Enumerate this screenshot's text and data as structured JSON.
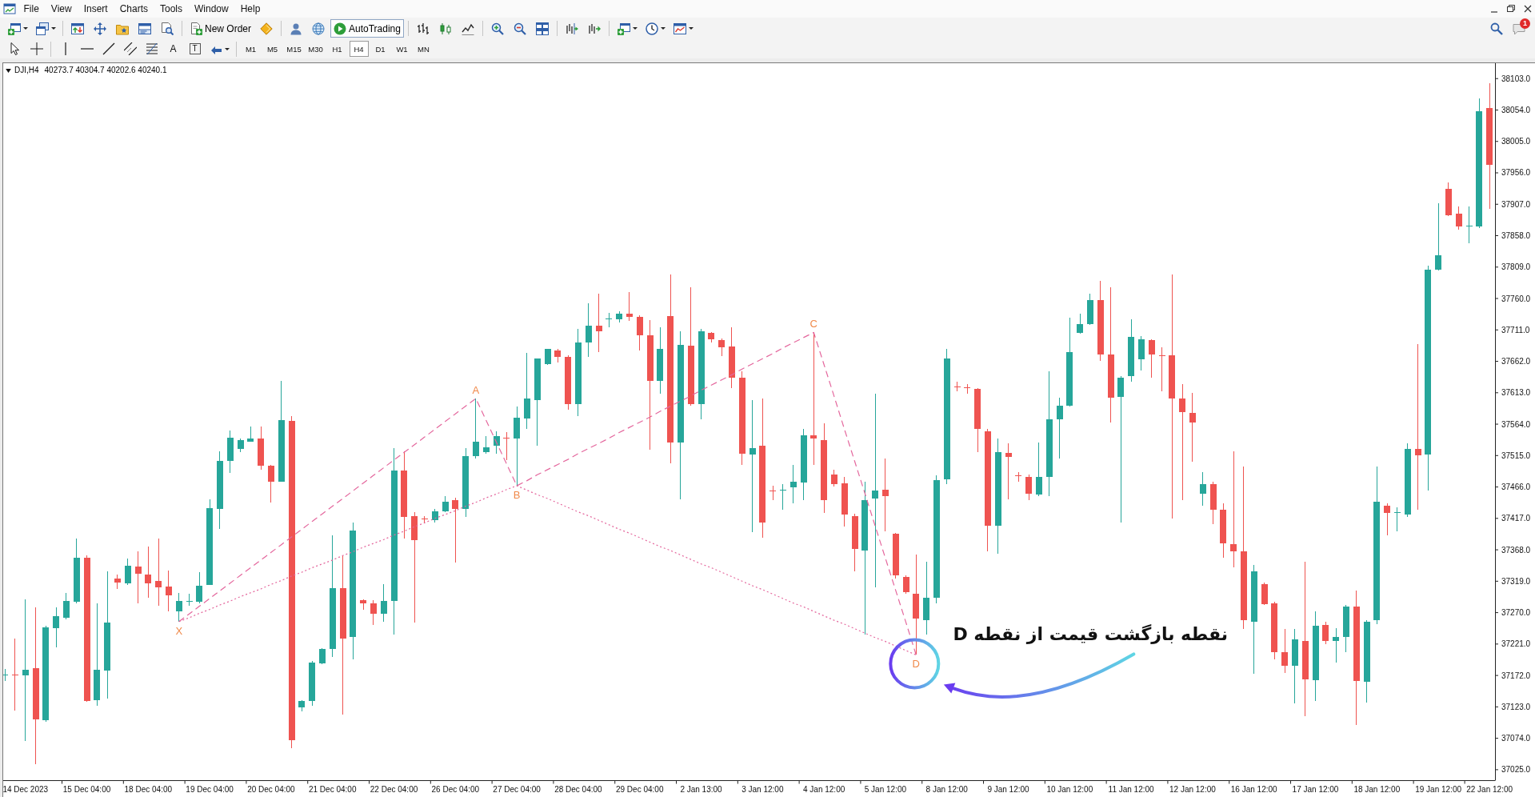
{
  "menu_bar": {
    "items": [
      "File",
      "View",
      "Insert",
      "Charts",
      "Tools",
      "Window",
      "Help"
    ]
  },
  "toolbar": {
    "new_order": {
      "label": "New Order"
    },
    "autotrading": {
      "label": "AutoTrading",
      "on": true
    },
    "notification_count": "1"
  },
  "drawing_tools": [
    {
      "kind": "cursor"
    },
    {
      "kind": "crosshair"
    },
    {
      "kind": "vertical-line"
    },
    {
      "kind": "horizontal-line"
    },
    {
      "kind": "trendline"
    },
    {
      "kind": "channel"
    },
    {
      "kind": "fibonacci"
    },
    {
      "kind": "text",
      "glyph": "A"
    },
    {
      "kind": "label",
      "glyph": "T"
    },
    {
      "kind": "arrows"
    }
  ],
  "timeframes": [
    {
      "label": "M1",
      "selected": false
    },
    {
      "label": "M5",
      "selected": false
    },
    {
      "label": "M15",
      "selected": false
    },
    {
      "label": "M30",
      "selected": false
    },
    {
      "label": "H1",
      "selected": false
    },
    {
      "label": "H4",
      "selected": true
    },
    {
      "label": "D1",
      "selected": false
    },
    {
      "label": "W1",
      "selected": false
    },
    {
      "label": "MN",
      "selected": false
    }
  ],
  "chart": {
    "quote": "40273.7 40304.7 40202.6 40240.1",
    "callout": {
      "text": "نقطه بازگشت قیمت از نقطه D"
    },
    "chart_data": [
      {
        "type": "candlestick",
        "title": "DJI,H4",
        "categories": [
          null,
          null,
          "14 Dec 2023",
          null,
          null,
          null,
          null,
          null,
          "15 Dec 04:00",
          null,
          null,
          null,
          null,
          null,
          "18 Dec 04:00",
          null,
          null,
          null,
          null,
          null,
          "19 Dec 04:00",
          null,
          null,
          null,
          null,
          null,
          "20 Dec 04:00",
          null,
          null,
          null,
          null,
          null,
          "21 Dec 04:00",
          null,
          null,
          null,
          null,
          null,
          "22 Dec 04:00",
          null,
          null,
          null,
          null,
          null,
          "26 Dec 04:00",
          null,
          null,
          null,
          null,
          null,
          "27 Dec 04:00",
          null,
          null,
          null,
          null,
          null,
          "28 Dec 04:00",
          null,
          null,
          null,
          null,
          null,
          "29 Dec 04:00",
          null,
          null,
          null,
          null,
          null,
          "2 Jan 13:00",
          null,
          null,
          null,
          null,
          null,
          "3 Jan 12:00",
          null,
          null,
          null,
          null,
          null,
          "4 Jan 12:00",
          null,
          null,
          null,
          null,
          null,
          "5 Jan 12:00",
          null,
          null,
          null,
          null,
          null,
          "8 Jan 12:00",
          null,
          null,
          null,
          null,
          null,
          "9 Jan 12:00",
          null,
          null,
          null,
          null,
          null,
          "10 Jan 12:00",
          null,
          null,
          null,
          null,
          null,
          "11 Jan 12:00",
          null,
          null,
          null,
          null,
          null,
          "12 Jan 12:00",
          null,
          null,
          null,
          null,
          null,
          "16 Jan 12:00",
          null,
          null,
          null,
          null,
          null,
          "17 Jan 12:00",
          null,
          null,
          null,
          null,
          null,
          "18 Jan 12:00",
          null,
          null,
          null,
          null,
          null,
          "19 Jan 12:00",
          null,
          null,
          null,
          null,
          "22 Jan 12:00"
        ],
        "ylim": [
          37008,
          38127
        ],
        "yticks": [
          {
            "value": 38103,
            "label": "38103.0"
          },
          {
            "value": 38054,
            "label": "38054.0"
          },
          {
            "value": 38005,
            "label": "38005.0"
          },
          {
            "value": 37956,
            "label": "37956.0"
          },
          {
            "value": 37907,
            "label": "37907.0"
          },
          {
            "value": 37858,
            "label": "37858.0"
          },
          {
            "value": 37809,
            "label": "37809.0"
          },
          {
            "value": 37760,
            "label": "37760.0"
          },
          {
            "value": 37711,
            "label": "37711.0"
          },
          {
            "value": 37662,
            "label": "37662.0"
          },
          {
            "value": 37613,
            "label": "37613.0"
          },
          {
            "value": 37564,
            "label": "37564.0"
          },
          {
            "value": 37515,
            "label": "37515.0"
          },
          {
            "value": 37466,
            "label": "37466.0"
          },
          {
            "value": 37417,
            "label": "37417.0"
          },
          {
            "value": 37368,
            "label": "37368.0"
          },
          {
            "value": 37319,
            "label": "37319.0"
          },
          {
            "value": 37270,
            "label": "37270.0"
          },
          {
            "value": 37221,
            "label": "37221.0"
          },
          {
            "value": 37172,
            "label": "37172.0"
          },
          {
            "value": 37123,
            "label": "37123.0"
          },
          {
            "value": 37074,
            "label": "37074.0"
          },
          {
            "value": 37025,
            "label": "37025.0"
          }
        ],
        "ohlc": [
          [
            37172,
            37182,
            37163,
            37173
          ],
          [
            37173,
            37230,
            37117,
            37172
          ],
          [
            37172,
            37291,
            37070,
            37181
          ],
          [
            37183,
            37278,
            37033,
            37103
          ],
          [
            37102,
            37249,
            37100,
            37247
          ],
          [
            37246,
            37278,
            37216,
            37264
          ],
          [
            37262,
            37301,
            37260,
            37288
          ],
          [
            37287,
            37386,
            37285,
            37356
          ],
          [
            37356,
            37359,
            37131,
            37132
          ],
          [
            37134,
            37285,
            37125,
            37181
          ],
          [
            37180,
            37335,
            37136,
            37255
          ],
          [
            37323,
            37330,
            37307,
            37317
          ],
          [
            37316,
            37354,
            37313,
            37343
          ],
          [
            37342,
            37365,
            37285,
            37331
          ],
          [
            37330,
            37373,
            37293,
            37316
          ],
          [
            37320,
            37385,
            37281,
            37310
          ],
          [
            37311,
            37336,
            37272,
            37297
          ],
          [
            37272,
            37301,
            37256,
            37288
          ],
          [
            37287,
            37299,
            37281,
            37288
          ],
          [
            37287,
            37333,
            37285,
            37312
          ],
          [
            37313,
            37447,
            37313,
            37433
          ],
          [
            37432,
            37522,
            37401,
            37507
          ],
          [
            37507,
            37554,
            37488,
            37543
          ],
          [
            37525,
            37541,
            37520,
            37539
          ],
          [
            37537,
            37560,
            37536,
            37542
          ],
          [
            37542,
            37560,
            37493,
            37499
          ],
          [
            37499,
            37501,
            37442,
            37474
          ],
          [
            37474,
            37631,
            37474,
            37570
          ],
          [
            37569,
            37577,
            37058,
            37071
          ],
          [
            37122,
            37134,
            37116,
            37132
          ],
          [
            37132,
            37195,
            37125,
            37192
          ],
          [
            37191,
            37214,
            37190,
            37213
          ],
          [
            37213,
            37390,
            37201,
            37308
          ],
          [
            37308,
            37359,
            37111,
            37230
          ],
          [
            37232,
            37410,
            37197,
            37398
          ],
          [
            37289,
            37291,
            37274,
            37285
          ],
          [
            37285,
            37289,
            37251,
            37268
          ],
          [
            37268,
            37314,
            37256,
            37288
          ],
          [
            37288,
            37527,
            37236,
            37492
          ],
          [
            37492,
            37522,
            37386,
            37419
          ],
          [
            37421,
            37427,
            37255,
            37383
          ],
          [
            37417,
            37421,
            37411,
            37416
          ],
          [
            37414,
            37432,
            37411,
            37428
          ],
          [
            37428,
            37452,
            37427,
            37443
          ],
          [
            37446,
            37449,
            37348,
            37432
          ],
          [
            37432,
            37526,
            37419,
            37514
          ],
          [
            37514,
            37604,
            37511,
            37536
          ],
          [
            37520,
            37545,
            37518,
            37528
          ],
          [
            37530,
            37553,
            37518,
            37545
          ],
          [
            37543,
            37551,
            37508,
            37542
          ],
          [
            37541,
            37591,
            37467,
            37574
          ],
          [
            37573,
            37675,
            37556,
            37604
          ],
          [
            37602,
            37667,
            37530,
            37666
          ],
          [
            37658,
            37682,
            37656,
            37681
          ],
          [
            37679,
            37682,
            37660,
            37669
          ],
          [
            37669,
            37671,
            37587,
            37595
          ],
          [
            37595,
            37713,
            37577,
            37692
          ],
          [
            37692,
            37753,
            37669,
            37717
          ],
          [
            37717,
            37768,
            37676,
            37709
          ],
          [
            37728,
            37737,
            37715,
            37729
          ],
          [
            37728,
            37740,
            37722,
            37736
          ],
          [
            37736,
            37770,
            37725,
            37731
          ],
          [
            37731,
            37734,
            37679,
            37703
          ],
          [
            37703,
            37726,
            37524,
            37631
          ],
          [
            37631,
            37715,
            37612,
            37682
          ],
          [
            37732,
            37797,
            37503,
            37535
          ],
          [
            37535,
            37709,
            37447,
            37688
          ],
          [
            37686,
            37778,
            37593,
            37595
          ],
          [
            37595,
            37713,
            37572,
            37709
          ],
          [
            37706,
            37708,
            37692,
            37696
          ],
          [
            37695,
            37698,
            37670,
            37684
          ],
          [
            37685,
            37715,
            37620,
            37637
          ],
          [
            37637,
            37647,
            37501,
            37518
          ],
          [
            37517,
            37602,
            37396,
            37527
          ],
          [
            37530,
            37604,
            37387,
            37411
          ],
          [
            37460,
            37468,
            37445,
            37459
          ],
          [
            37460,
            37471,
            37430,
            37462
          ],
          [
            37465,
            37500,
            37441,
            37474
          ],
          [
            37473,
            37556,
            37445,
            37546
          ],
          [
            37547,
            37707,
            37500,
            37541
          ],
          [
            37539,
            37565,
            37426,
            37445
          ],
          [
            37485,
            37493,
            37467,
            37471
          ],
          [
            37472,
            37482,
            37404,
            37423
          ],
          [
            37421,
            37424,
            37334,
            37369
          ],
          [
            37367,
            37474,
            37236,
            37446
          ],
          [
            37448,
            37611,
            37310,
            37461
          ],
          [
            37462,
            37510,
            37397,
            37452
          ],
          [
            37393,
            37394,
            37323,
            37328
          ],
          [
            37326,
            37328,
            37300,
            37302
          ],
          [
            37300,
            37360,
            37204,
            37261
          ],
          [
            37258,
            37350,
            37236,
            37293
          ],
          [
            37293,
            37484,
            37284,
            37477
          ],
          [
            37478,
            37682,
            37471,
            37667
          ],
          [
            37623,
            37630,
            37615,
            37622
          ],
          [
            37621,
            37626,
            37611,
            37620
          ],
          [
            37619,
            37620,
            37521,
            37556
          ],
          [
            37553,
            37556,
            37365,
            37406
          ],
          [
            37406,
            37541,
            37362,
            37521
          ],
          [
            37519,
            37534,
            37447,
            37513
          ],
          [
            37484,
            37489,
            37474,
            37483
          ],
          [
            37482,
            37485,
            37445,
            37456
          ],
          [
            37454,
            37535,
            37452,
            37482
          ],
          [
            37482,
            37646,
            37452,
            37571
          ],
          [
            37571,
            37605,
            37511,
            37593
          ],
          [
            37593,
            37730,
            37591,
            37676
          ],
          [
            37706,
            37736,
            37705,
            37720
          ],
          [
            37720,
            37767,
            37719,
            37758
          ],
          [
            37758,
            37787,
            37663,
            37673
          ],
          [
            37673,
            37778,
            37567,
            37605
          ],
          [
            37606,
            37639,
            37411,
            37637
          ],
          [
            37639,
            37728,
            37630,
            37700
          ],
          [
            37665,
            37701,
            37648,
            37696
          ],
          [
            37695,
            37696,
            37637,
            37673
          ],
          [
            37672,
            37684,
            37615,
            37671
          ],
          [
            37672,
            37798,
            37417,
            37604
          ],
          [
            37604,
            37626,
            37445,
            37583
          ],
          [
            37582,
            37613,
            37506,
            37567
          ],
          [
            37456,
            37489,
            37437,
            37471
          ],
          [
            37471,
            37474,
            37408,
            37430
          ],
          [
            37430,
            37441,
            37356,
            37378
          ],
          [
            37377,
            37522,
            37341,
            37366
          ],
          [
            37365,
            37498,
            37245,
            37258
          ],
          [
            37256,
            37345,
            37175,
            37335
          ],
          [
            37315,
            37317,
            37282,
            37283
          ],
          [
            37284,
            37287,
            37197,
            37208
          ],
          [
            37208,
            37245,
            37176,
            37187
          ],
          [
            37187,
            37245,
            37128,
            37228
          ],
          [
            37226,
            37349,
            37108,
            37166
          ],
          [
            37165,
            37272,
            37132,
            37249
          ],
          [
            37251,
            37256,
            37221,
            37226
          ],
          [
            37226,
            37246,
            37192,
            37232
          ],
          [
            37232,
            37282,
            37208,
            37280
          ],
          [
            37280,
            37304,
            37095,
            37164
          ],
          [
            37162,
            37258,
            37130,
            37256
          ],
          [
            37258,
            37498,
            37252,
            37443
          ],
          [
            37437,
            37441,
            37391,
            37425
          ],
          [
            37426,
            37434,
            37397,
            37427
          ],
          [
            37423,
            37534,
            37419,
            37525
          ],
          [
            37525,
            37689,
            37430,
            37515
          ],
          [
            37517,
            37811,
            37461,
            37805
          ],
          [
            37805,
            37909,
            37804,
            37827
          ],
          [
            37931,
            37941,
            37889,
            37890
          ],
          [
            37892,
            37904,
            37867,
            37872
          ],
          [
            37872,
            37904,
            37846,
            37873
          ],
          [
            37872,
            38072,
            37870,
            38052
          ],
          [
            38057,
            38096,
            37900,
            37969
          ]
        ],
        "series": [
          {
            "type": "line",
            "line_style": "dashed",
            "color": "#e4679d",
            "values": [
              null,
              null,
              null,
              null,
              null,
              null,
              null,
              null,
              null,
              null,
              null,
              null,
              null,
              null,
              null,
              null,
              null,
              37256,
              37268,
              37280,
              37292,
              37304,
              37316,
              37328,
              37340,
              37352,
              37364,
              37376,
              37388,
              37400,
              37412,
              37424,
              37436,
              37448,
              37460,
              37472,
              37484,
              37496,
              37508,
              37520,
              37532,
              37544,
              37556,
              37568,
              37580,
              37592,
              37604,
              37570,
              37536,
              37502,
              37468,
              37476,
              37485,
              37493,
              37501,
              37509,
              37518,
              37526,
              37534,
              37542,
              37551,
              37559,
              37567,
              37575,
              37584,
              37592,
              37600,
              37608,
              37617,
              37625,
              37633,
              37641,
              37650,
              37658,
              37666,
              37674,
              37683,
              37691,
              37699,
              37707,
              37657,
              37607,
              37556,
              37506,
              37456,
              37405,
              37355,
              37305,
              37255,
              37204,
              null,
              null,
              null,
              null,
              null,
              null,
              null,
              null,
              null,
              null,
              null,
              null,
              null,
              null,
              null,
              null,
              null,
              null,
              null,
              null,
              null,
              null,
              null,
              null,
              null,
              null,
              null,
              null,
              null,
              null,
              null,
              null,
              null,
              null,
              null,
              null,
              null,
              null,
              null,
              null,
              null,
              null,
              null,
              null,
              null,
              null,
              null,
              null,
              null,
              null,
              null,
              null,
              null,
              null,
              null,
              null
            ]
          },
          {
            "type": "line",
            "line_style": "dotted",
            "color": "#e4679d",
            "values": [
              null,
              null,
              null,
              null,
              null,
              null,
              null,
              null,
              null,
              null,
              null,
              null,
              null,
              null,
              null,
              null,
              null,
              37256,
              37262,
              37269,
              37275,
              37282,
              37288,
              37295,
              37301,
              37307,
              37314,
              37320,
              37327,
              37333,
              37340,
              37346,
              37352,
              37359,
              37365,
              37372,
              37378,
              37384,
              37391,
              37397,
              37404,
              37410,
              37417,
              37423,
              37429,
              37436,
              37442,
              37449,
              37455,
              37462,
              37468,
              37461,
              37454,
              37448,
              37441,
              37434,
              37427,
              37421,
              37414,
              37407,
              37400,
              37394,
              37387,
              37380,
              37373,
              37367,
              37360,
              37353,
              37346,
              37340,
              37333,
              37326,
              37319,
              37312,
              37306,
              37299,
              37292,
              37285,
              37279,
              37272,
              37265,
              37258,
              37252,
              37245,
              37238,
              37231,
              37225,
              37218,
              37211,
              37204,
              null,
              null,
              null,
              null,
              null,
              null,
              null,
              null,
              null,
              null,
              null,
              null,
              null,
              null,
              null,
              null,
              null,
              null,
              null,
              null,
              null,
              null,
              null,
              null,
              null,
              null,
              null,
              null,
              null,
              null,
              null,
              null,
              null,
              null,
              null,
              null,
              null,
              null,
              null,
              null,
              null,
              null,
              null,
              null,
              null,
              null,
              null,
              null,
              null,
              null,
              null,
              null,
              null,
              null,
              null,
              null
            ]
          }
        ],
        "annotations": [
          "X",
          "A",
          "B",
          "C",
          "D"
        ]
      }
    ]
  }
}
